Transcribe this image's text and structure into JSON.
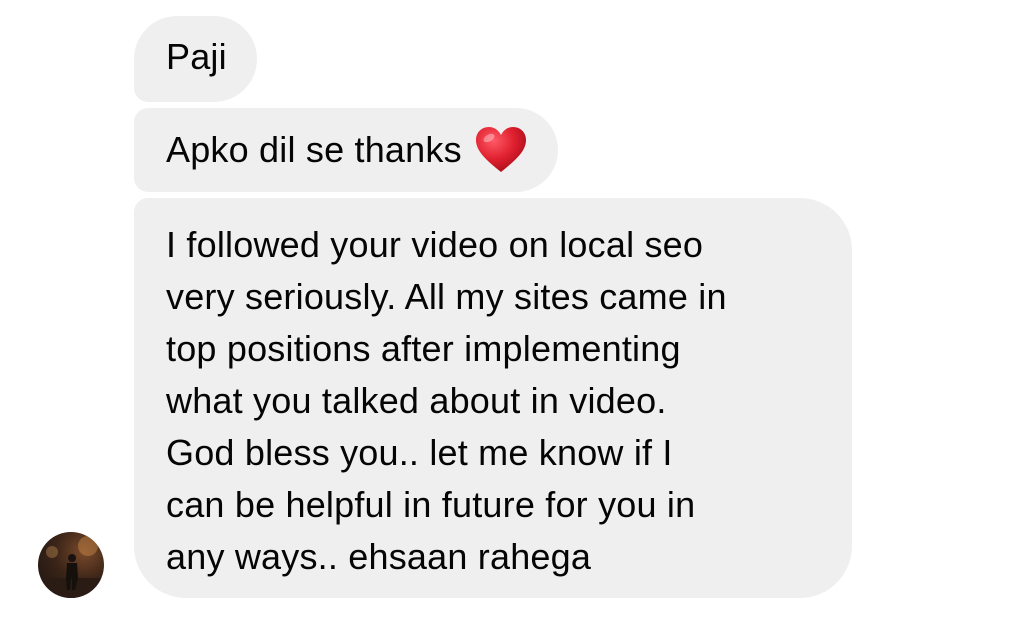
{
  "messages": [
    {
      "text": "Paji"
    },
    {
      "text": "Apko dil se thanks",
      "emoji": "red-heart"
    },
    {
      "lines": [
        "I followed your video on local seo",
        "very seriously. All my sites came in",
        "top positions after implementing",
        "what you talked about in video.",
        "God bless you.. let me know if I",
        "can be helpful in future for you in",
        "any ways.. ehsaan rahega"
      ]
    }
  ],
  "colors": {
    "bubble": "#efefef",
    "text": "#050505",
    "heart": "#e0202f"
  }
}
